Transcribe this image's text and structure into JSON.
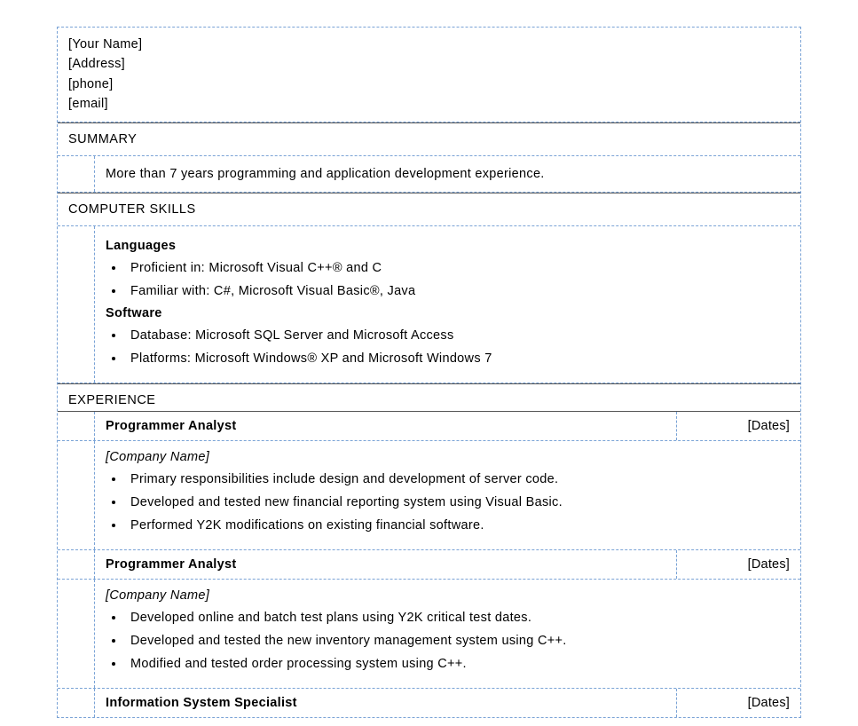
{
  "header": {
    "name": "[Your Name]",
    "address": "[Address]",
    "phone": "[phone]",
    "email": "[email]"
  },
  "sections": {
    "summary_label": "SUMMARY",
    "summary_text": "More than 7 years programming and application development experience.",
    "skills_label": "COMPUTER SKILLS",
    "skills": {
      "languages_label": "Languages",
      "languages_items": [
        "Proficient in: Microsoft Visual C++® and C",
        "Familiar with: C#, Microsoft Visual Basic®, Java"
      ],
      "software_label": "Software",
      "software_items": [
        "Database: Microsoft SQL Server and Microsoft Access",
        "Platforms: Microsoft Windows® XP and Microsoft Windows 7"
      ]
    },
    "experience_label": "EXPERIENCE",
    "jobs": [
      {
        "title": "Programmer Analyst",
        "dates": "[Dates]",
        "company": "[Company Name]",
        "bullets": [
          "Primary responsibilities include design and development of server code.",
          "Developed and tested new financial reporting system using Visual Basic.",
          "Performed Y2K modifications on existing financial software."
        ]
      },
      {
        "title": "Programmer Analyst",
        "dates": "[Dates]",
        "company": "[Company Name]",
        "bullets": [
          "Developed online and batch test plans using Y2K critical test dates.",
          "Developed and tested the new inventory management system using C++.",
          "Modified and tested order processing system using C++."
        ]
      },
      {
        "title": "Information System Specialist",
        "dates": "[Dates]"
      }
    ]
  }
}
